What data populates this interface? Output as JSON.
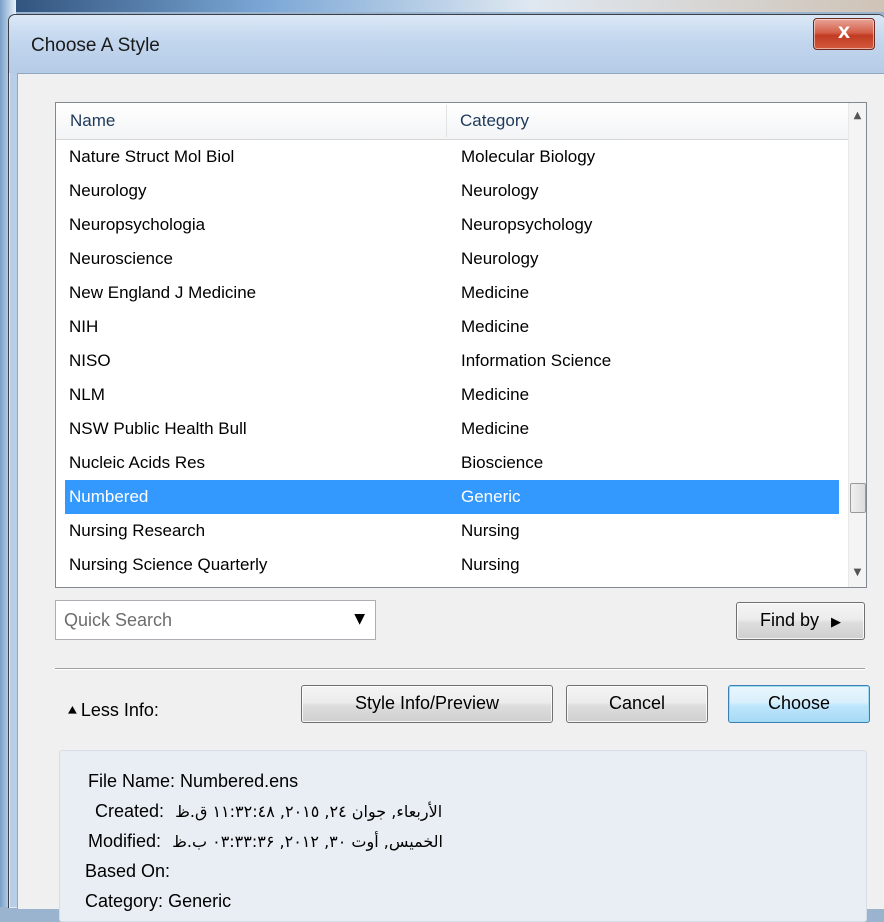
{
  "window": {
    "title": "Choose A Style",
    "close_label": "X"
  },
  "list": {
    "columns": {
      "name": "Name",
      "category": "Category"
    },
    "rows": [
      {
        "name": "Nature Struct Mol Biol",
        "category": "Molecular Biology"
      },
      {
        "name": "Neurology",
        "category": "Neurology"
      },
      {
        "name": "Neuropsychologia",
        "category": "Neuropsychology"
      },
      {
        "name": "Neuroscience",
        "category": "Neurology"
      },
      {
        "name": "New England J Medicine",
        "category": "Medicine"
      },
      {
        "name": "NIH",
        "category": "Medicine"
      },
      {
        "name": "NISO",
        "category": "Information Science"
      },
      {
        "name": "NLM",
        "category": "Medicine"
      },
      {
        "name": "NSW Public Health Bull",
        "category": "Medicine"
      },
      {
        "name": "Nucleic Acids Res",
        "category": "Bioscience"
      },
      {
        "name": "Numbered",
        "category": "Generic"
      },
      {
        "name": "Nursing Research",
        "category": "Nursing"
      },
      {
        "name": "Nursing Science Quarterly",
        "category": "Nursing"
      }
    ],
    "selected_index": 10
  },
  "search": {
    "placeholder": "Quick Search"
  },
  "buttons": {
    "find_by": "Find by",
    "less_info": "Less Info:",
    "style_info_preview": "Style Info/Preview",
    "cancel": "Cancel",
    "choose": "Choose"
  },
  "info": {
    "file_name_label": "File Name:",
    "file_name": "Numbered.ens",
    "created_label": "Created:",
    "created": "الأربعاء, جوان ٢٤, ٢٠١٥, ١١:٣٢:٤٨ ق.ظ",
    "modified_label": "Modified:",
    "modified": "الخميس, أوت ٣٠, ٢٠١٢, ٠٣:٣٣:٣۶ ب.ظ",
    "based_on_label": "Based On:",
    "based_on": "",
    "category_label": "Category:",
    "category": "Generic"
  }
}
